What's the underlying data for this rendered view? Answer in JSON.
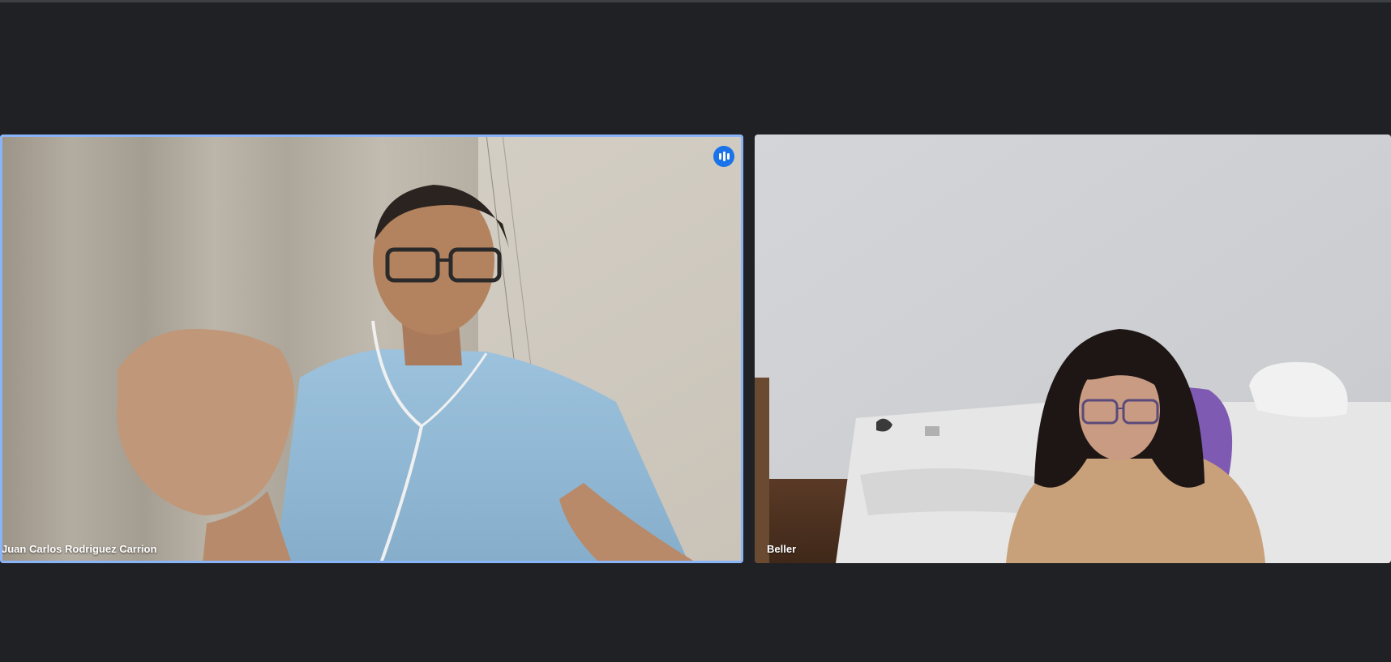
{
  "participants": [
    {
      "name": "Juan Carlos Rodriguez Carrion",
      "speaking": true
    },
    {
      "name": "Beller",
      "speaking": false
    }
  ],
  "colors": {
    "background": "#202124",
    "active_speaker_border": "#8ab4f8",
    "speaking_indicator": "#1a73e8"
  },
  "icons": {
    "speaking_indicator": "audio-level-icon"
  }
}
